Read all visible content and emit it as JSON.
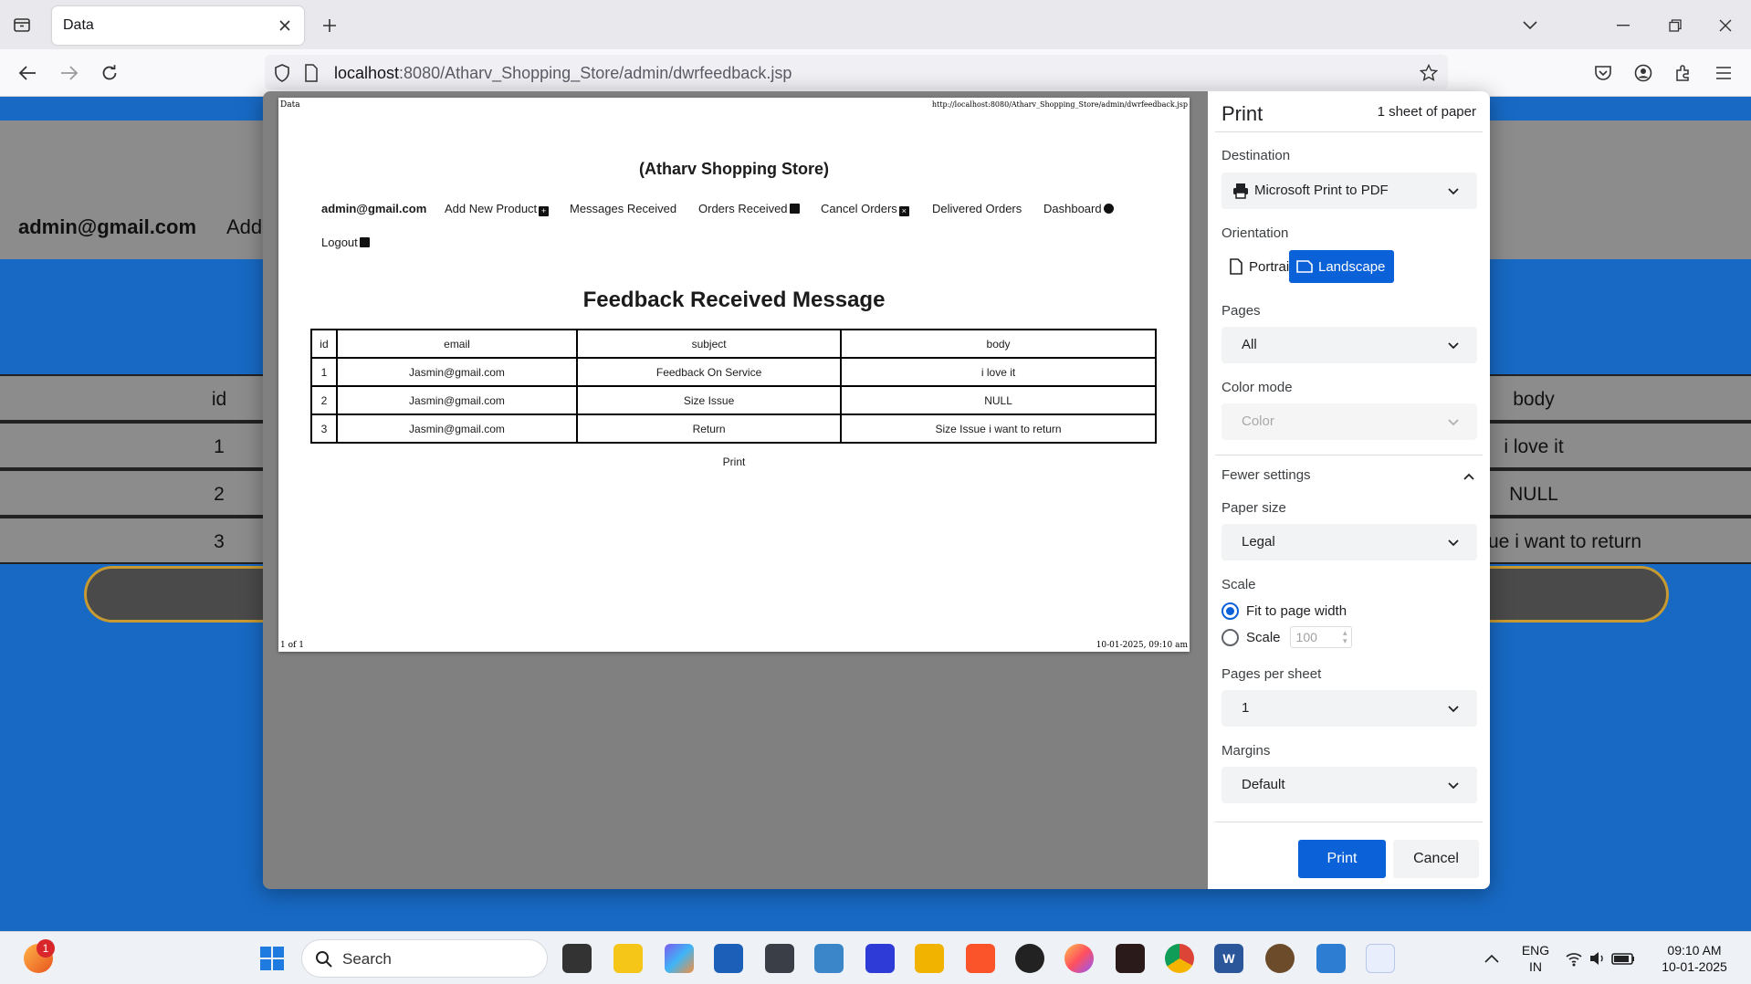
{
  "browser": {
    "tab_title": "Data",
    "url_host": "localhost",
    "url_rest": ":8080/Atharv_Shopping_Store/admin/dwrfeedback.jsp"
  },
  "background_page": {
    "admin_email": "admin@gmail.com",
    "add_label": "Add",
    "col_id": "id",
    "col_body": "body",
    "rows": [
      {
        "id": "1",
        "body": "i love it"
      },
      {
        "id": "2",
        "body": "NULL"
      },
      {
        "id": "3",
        "body": "ue i want to return"
      }
    ]
  },
  "preview": {
    "header_left": "Data",
    "header_right": "http://localhost:8080/Atharv_Shopping_Store/admin/dwrfeedback.jsp",
    "footer_left": "1 of 1",
    "footer_right": "10-01-2025, 09:10 am",
    "store_name": "(Atharv Shopping Store)",
    "nav": {
      "admin": "admin@gmail.com",
      "add_product": "Add New Product",
      "messages": "Messages Received",
      "orders": "Orders Received",
      "cancel": "Cancel Orders",
      "delivered": "Delivered Orders",
      "dashboard": "Dashboard",
      "logout": "Logout"
    },
    "heading": "Feedback Received Message",
    "table": {
      "headers": [
        "id",
        "email",
        "subject",
        "body"
      ],
      "rows": [
        [
          "1",
          "Jasmin@gmail.com",
          "Feedback On Service",
          "i love it"
        ],
        [
          "2",
          "Jasmin@gmail.com",
          "Size Issue",
          "NULL"
        ],
        [
          "3",
          "Jasmin@gmail.com",
          "Return",
          "Size Issue i want to return"
        ]
      ]
    },
    "print_link": "Print"
  },
  "print_panel": {
    "title": "Print",
    "sheets": "1 sheet of paper",
    "destination_label": "Destination",
    "destination_value": "Microsoft Print to PDF",
    "orientation_label": "Orientation",
    "portrait": "Portrait",
    "landscape": "Landscape",
    "orientation_selected": "Landscape",
    "pages_label": "Pages",
    "pages_value": "All",
    "color_label": "Color mode",
    "color_value": "Color",
    "fewer_settings": "Fewer settings",
    "paper_size_label": "Paper size",
    "paper_size_value": "Legal",
    "scale_label": "Scale",
    "fit_option": "Fit to page width",
    "scale_option": "Scale",
    "scale_placeholder": "100",
    "pps_label": "Pages per sheet",
    "pps_value": "1",
    "margins_label": "Margins",
    "margins_value": "Default",
    "print_button": "Print",
    "cancel_button": "Cancel"
  },
  "taskbar": {
    "search": "Search",
    "notification_count": "1",
    "lang_1": "ENG",
    "lang_2": "IN",
    "time": "09:10 AM",
    "date": "10-01-2025"
  },
  "colors": {
    "accent": "#0b61d8",
    "page_blue": "#1769c4",
    "overlay_gray": "#808080"
  }
}
